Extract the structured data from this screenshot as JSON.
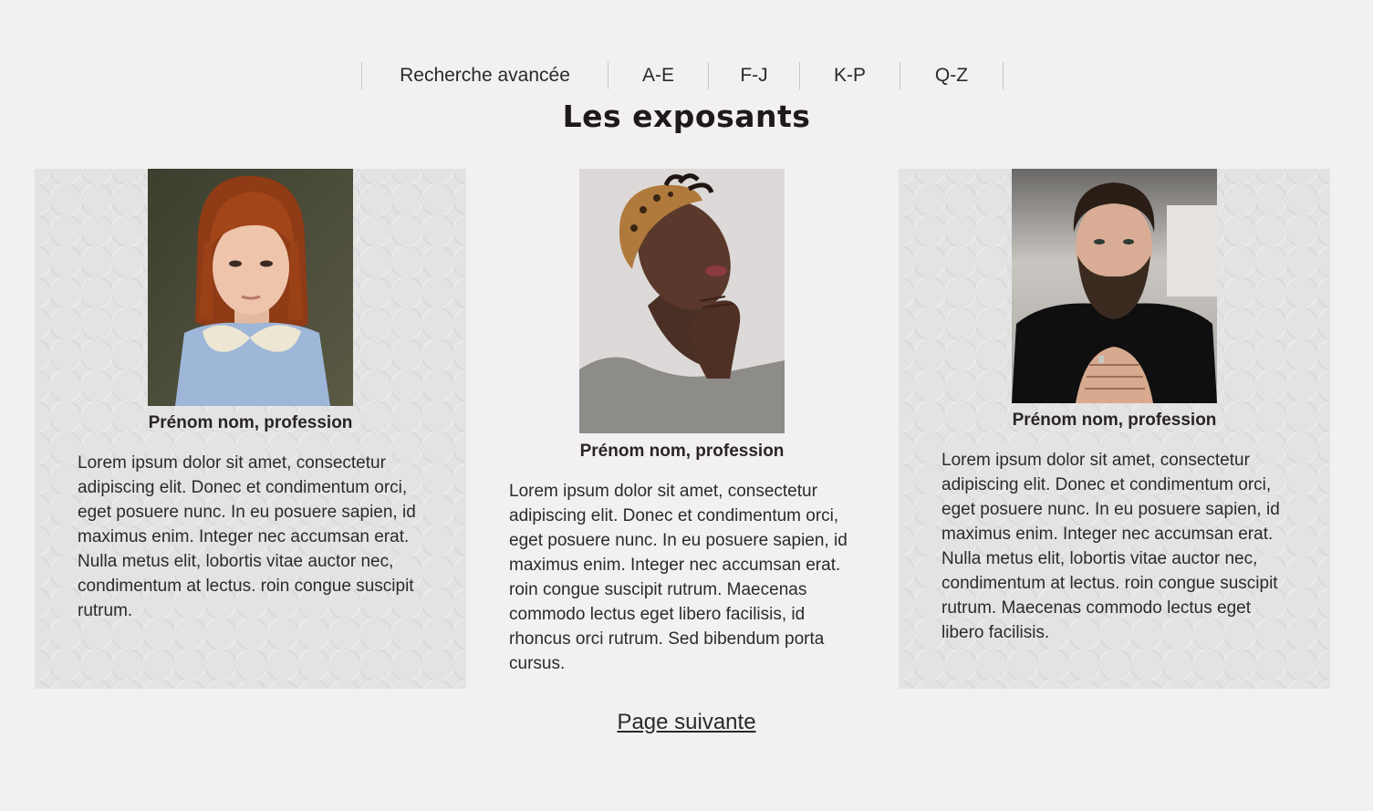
{
  "nav": {
    "items": [
      {
        "label": "Recherche avancée"
      },
      {
        "label": "A-E"
      },
      {
        "label": "F-J"
      },
      {
        "label": "K-P"
      },
      {
        "label": "Q-Z"
      }
    ]
  },
  "page": {
    "title": "Les exposants",
    "next_label": "Page suivante"
  },
  "exhibitors": [
    {
      "name": "Prénom nom, profession",
      "photo": "portrait-woman-red-hair",
      "text": "Lorem ipsum dolor sit amet, consectetur adipiscing elit. Donec et condimentum orci, eget posuere nunc. In eu posuere sapien, id maximus enim. Integer nec accumsan erat. Nulla metus elit, lobortis vitae auctor nec, condimentum at lectus. roin congue suscipit rutrum."
    },
    {
      "name": "Prénom nom, profession",
      "photo": "portrait-woman-headwrap",
      "text": "Lorem ipsum dolor sit amet, consectetur adipiscing elit. Donec et condimentum orci, eget posuere nunc. In eu posuere sapien, id maximus enim. Integer nec accumsan erat. roin congue suscipit rutrum. Maecenas commodo lectus eget libero facilisis, id rhoncus orci rutrum. Sed bibendum porta cursus."
    },
    {
      "name": "Prénom nom, profession",
      "photo": "portrait-bearded-man",
      "text": "Lorem ipsum dolor sit amet, consectetur adipiscing elit. Donec et condimentum orci, eget posuere nunc. In eu posuere sapien, id maximus enim. Integer nec accumsan erat. Nulla metus elit, lobortis vitae auctor nec, condimentum at lectus. roin congue suscipit rutrum. Maecenas commodo lectus eget libero facilisis."
    }
  ],
  "colors": {
    "background": "#f2f0f2",
    "card_background": "#e4e3e4",
    "text": "#2b2b2b"
  }
}
